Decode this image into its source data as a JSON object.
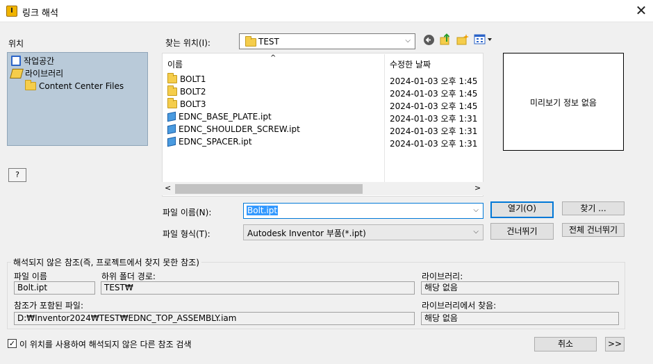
{
  "window": {
    "title": "링크 해석",
    "close_glyph": "✕"
  },
  "places": {
    "label": "위치",
    "items": [
      {
        "label": "작업공간",
        "icon": "workspace-icon"
      },
      {
        "label": "라이브러리",
        "icon": "library-icon"
      },
      {
        "label": "Content Center Files",
        "icon": "folder-icon"
      }
    ],
    "help_label": "?"
  },
  "look_in": {
    "label": "찾는 위치(I):",
    "value": "TEST",
    "toolbar_icons": [
      "back-icon",
      "up-folder-icon",
      "new-folder-icon",
      "view-menu-icon"
    ]
  },
  "file_list": {
    "sort_indicator": "^",
    "columns": {
      "name": "이름",
      "modified": "수정한 날짜"
    },
    "rows": [
      {
        "name": "BOLT1",
        "modified": "2024-01-03 오후 1:45",
        "type": "folder"
      },
      {
        "name": "BOLT2",
        "modified": "2024-01-03 오후 1:45",
        "type": "folder"
      },
      {
        "name": "BOLT3",
        "modified": "2024-01-03 오후 1:45",
        "type": "folder"
      },
      {
        "name": "EDNC_BASE_PLATE.ipt",
        "modified": "2024-01-03 오후 1:31",
        "type": "part"
      },
      {
        "name": "EDNC_SHOULDER_SCREW.ipt",
        "modified": "2024-01-03 오후 1:31",
        "type": "part"
      },
      {
        "name": "EDNC_SPACER.ipt",
        "modified": "2024-01-03 오후 1:31",
        "type": "part"
      }
    ],
    "scroll_left": "<",
    "scroll_right": ">"
  },
  "preview": {
    "text": "미리보기 정보 없음"
  },
  "file_name": {
    "label": "파일 이름(N):",
    "value": "Bolt.ipt"
  },
  "file_type": {
    "label": "파일 형식(T):",
    "value": "Autodesk Inventor 부품(*.ipt)"
  },
  "buttons": {
    "open": "열기(O)",
    "find": "찾기 ...",
    "skip": "건너뛰기",
    "skip_all": "전체 건너뛰기",
    "cancel": "취소",
    "expand": ">>"
  },
  "unresolved": {
    "group_title": "해석되지 않은 참조(즉, 프로젝트에서 찾지 못한 참조)",
    "file_name_label": "파일 이름",
    "file_name_value": "Bolt.ipt",
    "subfolder_label": "하위 폴더 경로:",
    "subfolder_value": "TEST₩",
    "library_label": "라이브러리:",
    "library_value": "해당 없음",
    "containing_label": "참조가 포함된 파일:",
    "containing_value": "D:₩Inventor2024₩TEST₩EDNC_TOP_ASSEMBLY.iam",
    "found_in_library_label": "라이브러리에서 찾음:",
    "found_in_library_value": "해당 없음"
  },
  "search_option": {
    "label": "이 위치를 사용하여 해석되지 않은 다른 참조 검색",
    "checked": true
  },
  "colors": {
    "accent": "#0078d7",
    "places_bg": "#b9cad9",
    "selection": "#3399ff"
  }
}
